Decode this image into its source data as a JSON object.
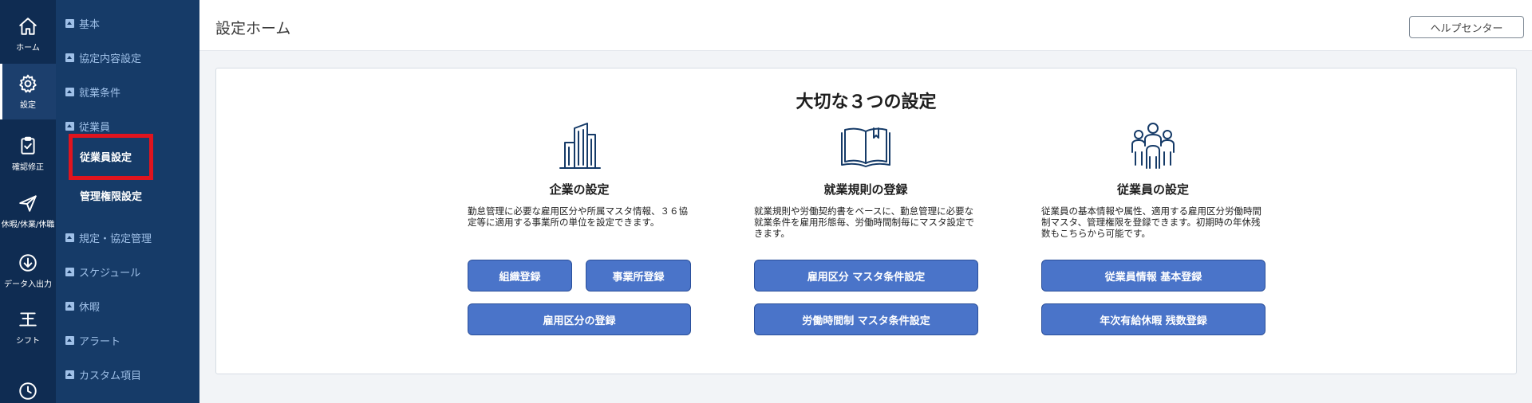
{
  "rail": {
    "items": [
      {
        "label": "ホーム",
        "icon": "home-icon"
      },
      {
        "label": "設定",
        "icon": "gear-icon"
      },
      {
        "label": "確認修正",
        "icon": "clipboard-check-icon"
      },
      {
        "label": "休暇/休業/休職",
        "icon": "plane-icon"
      },
      {
        "label": "データ入出力",
        "icon": "download-icon"
      },
      {
        "label": "シフト",
        "icon": "shift-icon"
      },
      {
        "label": "",
        "icon": "clock-icon"
      }
    ]
  },
  "subnav": {
    "categories": [
      "基本",
      "協定内容設定",
      "就業条件",
      "従業員",
      "規定・協定管理",
      "スケジュール",
      "休暇",
      "アラート",
      "カスタム項目"
    ],
    "employee_items": [
      "従業員設定",
      "管理権限設定"
    ]
  },
  "header": {
    "title": "設定ホーム",
    "help_label": "ヘルプセンター"
  },
  "card": {
    "title": "大切な３つの設定",
    "columns": [
      {
        "icon": "building-icon",
        "title": "企業の設定",
        "desc": "勤怠管理に必要な雇用区分や所属マスタ情報、３６協定等に適用する事業所の単位を設定できます。",
        "buttons": [
          "組織登録",
          "事業所登録",
          "雇用区分の登録"
        ]
      },
      {
        "icon": "book-icon",
        "title": "就業規則の登録",
        "desc": "就業規則や労働契約書をベースに、勤怠管理に必要な就業条件を雇用形態毎、労働時間制毎にマスタ設定できます。",
        "buttons": [
          "雇用区分 マスタ条件設定",
          "労働時間制 マスタ条件設定"
        ]
      },
      {
        "icon": "people-icon",
        "title": "従業員の設定",
        "desc": "従業員の基本情報や属性、適用する雇用区分労働時間制マスタ、管理権限を登録できます。初期時の年休残数もこちらから可能です。",
        "buttons": [
          "従業員情報 基本登録",
          "年次有給休暇 残数登録"
        ]
      }
    ]
  },
  "colors": {
    "rail_bg": "#0f2c52",
    "subnav_bg": "#163b68",
    "button_bg": "#4a74c9",
    "highlight": "#e0141e"
  }
}
